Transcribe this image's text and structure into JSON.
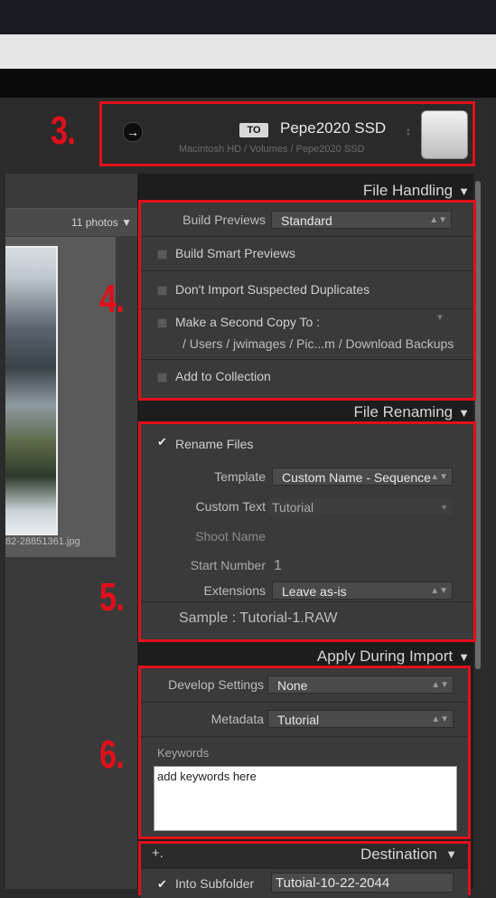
{
  "grid": {
    "photo_count": "11 photos",
    "thumb_filename": "82-28851361.jpg"
  },
  "destination": {
    "to_badge": "TO",
    "drive_name": "Pepe2020 SSD",
    "drive_chevron": "↕",
    "path": "Macintosh HD / Volumes / Pepe2020 SSD",
    "arrow_icon": "→"
  },
  "annotations": {
    "n3": "3.",
    "n4": "4.",
    "n5": "5.",
    "n6": "6."
  },
  "file_handling": {
    "header": "File Handling",
    "build_previews_label": "Build Previews",
    "build_previews_value": "Standard",
    "build_smart_previews": "Build Smart Previews",
    "dont_import_duplicates": "Don't Import Suspected Duplicates",
    "second_copy_label": "Make a Second Copy To :",
    "second_copy_path": "/ Users / jwimages / Pic...m / Download Backups",
    "add_to_collection": "Add to Collection"
  },
  "file_renaming": {
    "header": "File Renaming",
    "rename_files": "Rename Files",
    "template_label": "Template",
    "template_value": "Custom Name - Sequence",
    "custom_text_label": "Custom Text",
    "custom_text_value": "Tutorial",
    "shoot_name_label": "Shoot Name",
    "start_number_label": "Start Number",
    "start_number_value": "1",
    "extensions_label": "Extensions",
    "extensions_value": "Leave as-is",
    "sample": "Sample :  Tutorial-1.RAW"
  },
  "apply_during_import": {
    "header": "Apply During Import",
    "develop_label": "Develop Settings",
    "develop_value": "None",
    "metadata_label": "Metadata",
    "metadata_value": "Tutorial",
    "keywords_label": "Keywords",
    "keywords_value": "add keywords here"
  },
  "destination_panel": {
    "header": "Destination",
    "plus_icon": "+.",
    "into_subfolder": "Into Subfolder",
    "subfolder_value": "Tutoial-10-22-2044"
  },
  "icons": {
    "dropdown": "▲▼",
    "triangle": "▼",
    "check": "✔"
  },
  "colors": {
    "annotation_red": "#e0101a"
  }
}
